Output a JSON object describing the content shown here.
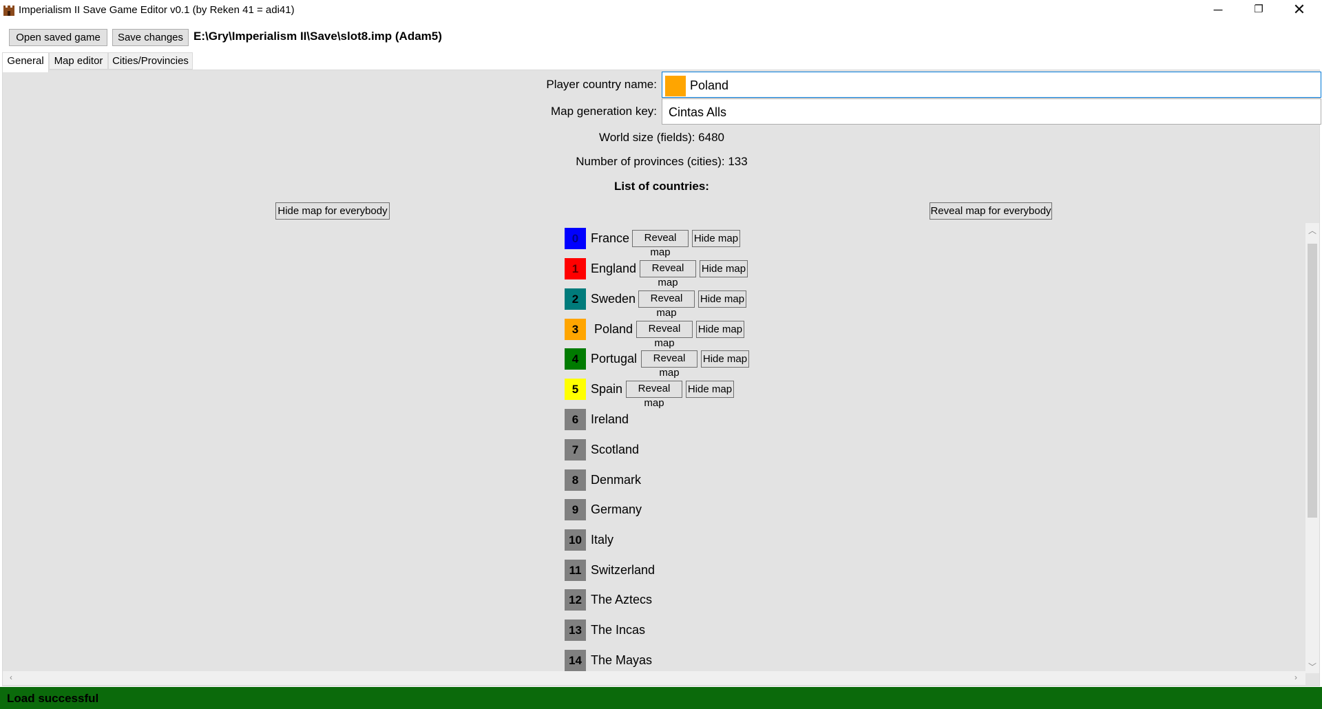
{
  "window": {
    "title": "Imperialism II Save Game Editor v0.1 (by Reken 41 = adi41)",
    "minimize": "─",
    "maximize": "❐",
    "close": "✕"
  },
  "toolbar": {
    "open_label": "Open saved game",
    "save_label": "Save changes",
    "file_path": "E:\\Gry\\Imperialism II\\Save\\slot8.imp (Adam5)"
  },
  "tabs": [
    {
      "label": "General"
    },
    {
      "label": "Map editor"
    },
    {
      "label": "Cities/Provincies"
    }
  ],
  "general": {
    "player_country_label": "Player country name:",
    "player_country_value": "Poland",
    "player_color": "#ffa500",
    "map_key_label": "Map generation key:",
    "map_key_value": "Cintas Alls",
    "world_size": "World size (fields): 6480",
    "provinces": "Number of provinces (cities): 133",
    "list_title": "List of countries:",
    "hide_all_label": "Hide map for everybody",
    "reveal_all_label": "Reveal map for everybody",
    "reveal_label": "Reveal map",
    "hide_label": "Hide map"
  },
  "countries": [
    {
      "num": "0",
      "name": "France",
      "color": "#0000ff"
    },
    {
      "num": "1",
      "name": "England",
      "color": "#ff0000"
    },
    {
      "num": "2",
      "name": "Sweden",
      "color": "#007b7b"
    },
    {
      "num": "3",
      "name": "Poland",
      "color": "#ffa500"
    },
    {
      "num": "4",
      "name": "Portugal",
      "color": "#007b00"
    },
    {
      "num": "5",
      "name": "Spain",
      "color": "#ffff00"
    },
    {
      "num": "6",
      "name": "Ireland",
      "color": "#808080"
    },
    {
      "num": "7",
      "name": "Scotland",
      "color": "#808080"
    },
    {
      "num": "8",
      "name": "Denmark",
      "color": "#808080"
    },
    {
      "num": "9",
      "name": "Germany",
      "color": "#808080"
    },
    {
      "num": "10",
      "name": "Italy",
      "color": "#808080"
    },
    {
      "num": "11",
      "name": "Switzerland",
      "color": "#808080"
    },
    {
      "num": "12",
      "name": "The Aztecs",
      "color": "#808080"
    },
    {
      "num": "13",
      "name": "The Incas",
      "color": "#808080"
    },
    {
      "num": "14",
      "name": "The Mayas",
      "color": "#808080"
    }
  ],
  "status": {
    "text": "Load successful",
    "color": "#0b6a0b"
  }
}
